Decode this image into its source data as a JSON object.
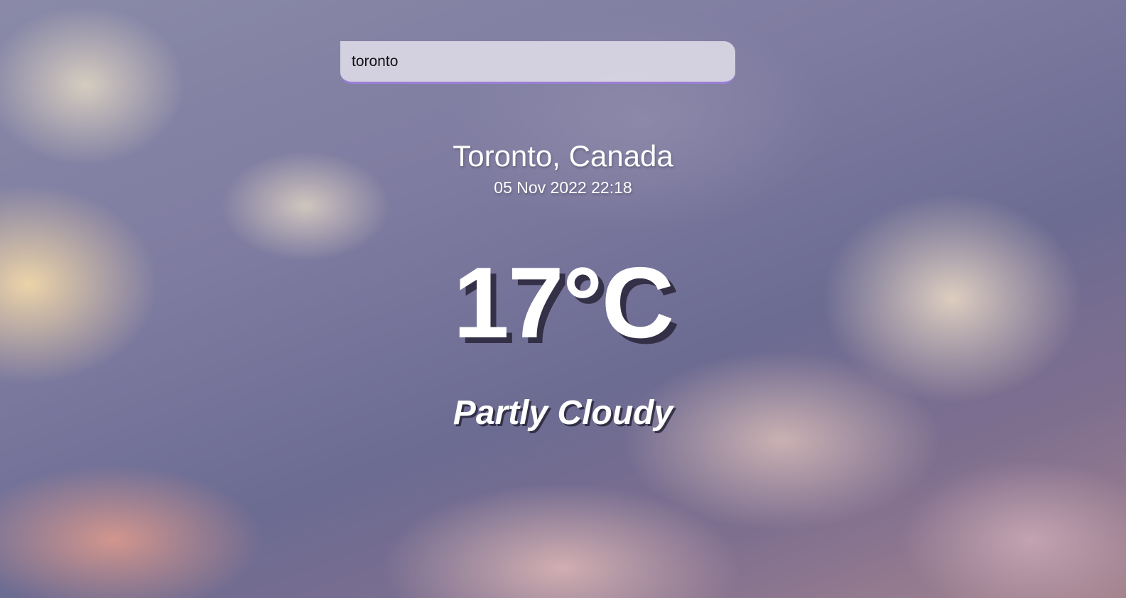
{
  "search": {
    "value": "toronto"
  },
  "location": {
    "name": "Toronto, Canada",
    "date": "05 Nov 2022 22:18"
  },
  "weather": {
    "temperature": "17°C",
    "condition": "Partly Cloudy"
  },
  "colors": {
    "search_underline": "#9b7fd6",
    "text": "#ffffff"
  }
}
